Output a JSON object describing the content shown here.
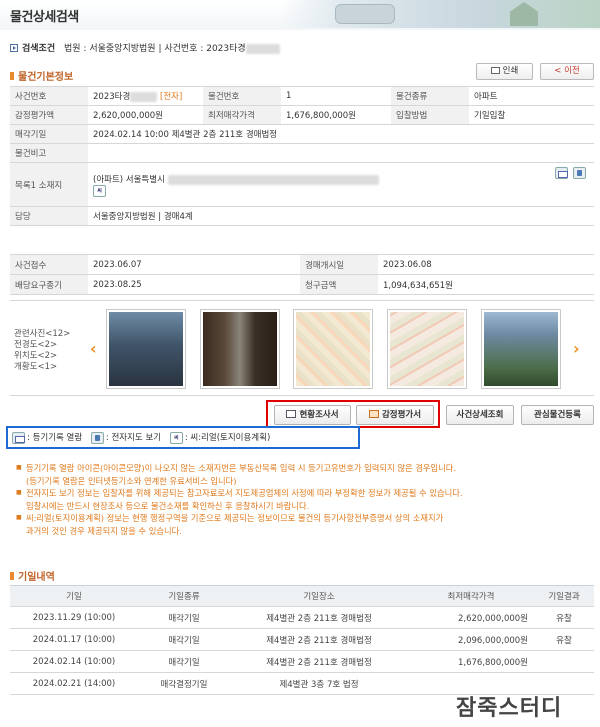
{
  "page": {
    "title": "물건상세검색"
  },
  "search_condition": {
    "label": "검색조건",
    "court_prefix": "법원 : ",
    "court": "서울중앙지방법원",
    "divider": " | ",
    "case_prefix": "사건번호 : ",
    "case_no": "2023타경"
  },
  "basic_info": {
    "section_title": "물건기본정보",
    "print_label": "인쇄",
    "prev_label": "< 이전",
    "rows": {
      "case_no_label": "사건번호",
      "case_no_value": "2023타경",
      "case_no_link": "[전자]",
      "item_no_label": "물건번호",
      "item_no_value": "1",
      "item_type_label": "물건종류",
      "item_type_value": "아파트",
      "appraisal_label": "감정평가액",
      "appraisal_value": "2,620,000,000원",
      "min_price_label": "최저매각가격",
      "min_price_value": "1,676,800,000원",
      "bid_method_label": "입찰방법",
      "bid_method_value": "기일입찰",
      "sale_date_label": "매각기일",
      "sale_date_value": "2024.02.14 10:00 제4별관 2층 211호 경매법정",
      "note_label": "물건비고",
      "note_value": "",
      "location_label": "목록1 소재지",
      "location_value": "(아파트) 서울특별시",
      "charge_label": "담당",
      "charge_value": "서울중앙지방법원 | 경매4계"
    }
  },
  "schedule": {
    "receipt_label": "사건접수",
    "receipt_value": "2023.06.07",
    "start_label": "경매개시일",
    "start_value": "2023.06.08",
    "deadline_label": "배당요구종기",
    "deadline_value": "2023.08.25",
    "claim_label": "청구금액",
    "claim_value": "1,094,634,651원"
  },
  "photos": {
    "labels": [
      "관련사진<12>",
      "전경도<2>",
      "위치도<2>",
      "개황도<1>"
    ]
  },
  "actions": {
    "status_report": "현황조사서",
    "appraisal_report": "감정평가서",
    "case_detail": "사건상세조회",
    "watchlist": "관심물건등록"
  },
  "legend": {
    "registry": ": 등기기록 열람",
    "map": ": 전자지도 보기",
    "land": ": 씨:리얼(토지이용계획)"
  },
  "notes": [
    {
      "line1": "등기기록 열람 아이콘(아이콘모양)이 나오지 않는 소재지번은 부동산목록 입력 시 등기고유번호가 입력되지 않은 경우입니다.",
      "line2": "(등기기록 열람은 인터넷등기소와 연계한 유료서비스 입니다)"
    },
    {
      "line1": "전자지도 보기 정보는 입찰자를 위해 제공되는 참고자료로서 지도제공업체의 사정에 따라 부정확한 정보가 제공될 수 있습니다.",
      "line2": "입찰시에는 반드시 현장조사 등으로 물건소재를 확인하신 후 응찰하시기 바랍니다."
    },
    {
      "line1": "씨:리얼(토지이용계획) 정보는 현행 행정구역을 기준으로 제공되는 정보이므로 물건의 등기사항전부증명서 상의 소재지가",
      "line2": "과거의 것인 경우 제공되지 않을 수 있습니다."
    }
  ],
  "history": {
    "section_title": "기일내역",
    "headers": [
      "기일",
      "기일종류",
      "기일장소",
      "최저매각가격",
      "기일결과"
    ],
    "rows": [
      [
        "2023.11.29 (10:00)",
        "매각기일",
        "제4별관 2층 211호 경매법정",
        "2,620,000,000원",
        "유찰"
      ],
      [
        "2024.01.17 (10:00)",
        "매각기일",
        "제4별관 2층 211호 경매법정",
        "2,096,000,000원",
        "유찰"
      ],
      [
        "2024.02.14 (10:00)",
        "매각기일",
        "제4별관 2층 211호 경매법정",
        "1,676,800,000원",
        ""
      ],
      [
        "2024.02.21 (14:00)",
        "매각결정기일",
        "제4별관 3층 7호 법정",
        "",
        ""
      ]
    ]
  },
  "watermark": "잠죽스터디"
}
